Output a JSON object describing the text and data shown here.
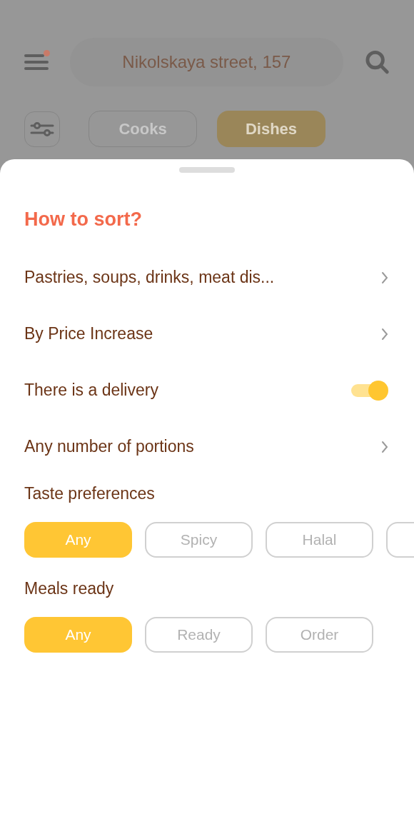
{
  "header": {
    "notification_dot": true,
    "address": "Nikolskaya street, 157"
  },
  "mode_tabs": [
    {
      "label": "Cooks",
      "selected": false
    },
    {
      "label": "Dishes",
      "selected": true
    }
  ],
  "sheet": {
    "title": "How to sort?",
    "rows": [
      {
        "kind": "link",
        "label": "Pastries, soups, drinks, meat dis..."
      },
      {
        "kind": "link",
        "label": "By Price Increase"
      },
      {
        "kind": "toggle",
        "label": "There is a delivery",
        "on": true
      },
      {
        "kind": "link",
        "label": "Any number of portions"
      }
    ],
    "groups": [
      {
        "title": "Taste preferences",
        "chips": [
          {
            "label": "Any",
            "selected": true
          },
          {
            "label": "Spicy",
            "selected": false
          },
          {
            "label": "Halal",
            "selected": false
          },
          {
            "selected": false
          }
        ]
      },
      {
        "title": "Meals ready",
        "chips": [
          {
            "label": "Any",
            "selected": true
          },
          {
            "label": "Ready",
            "selected": false
          },
          {
            "label": "Order",
            "selected": false
          }
        ]
      }
    ]
  }
}
